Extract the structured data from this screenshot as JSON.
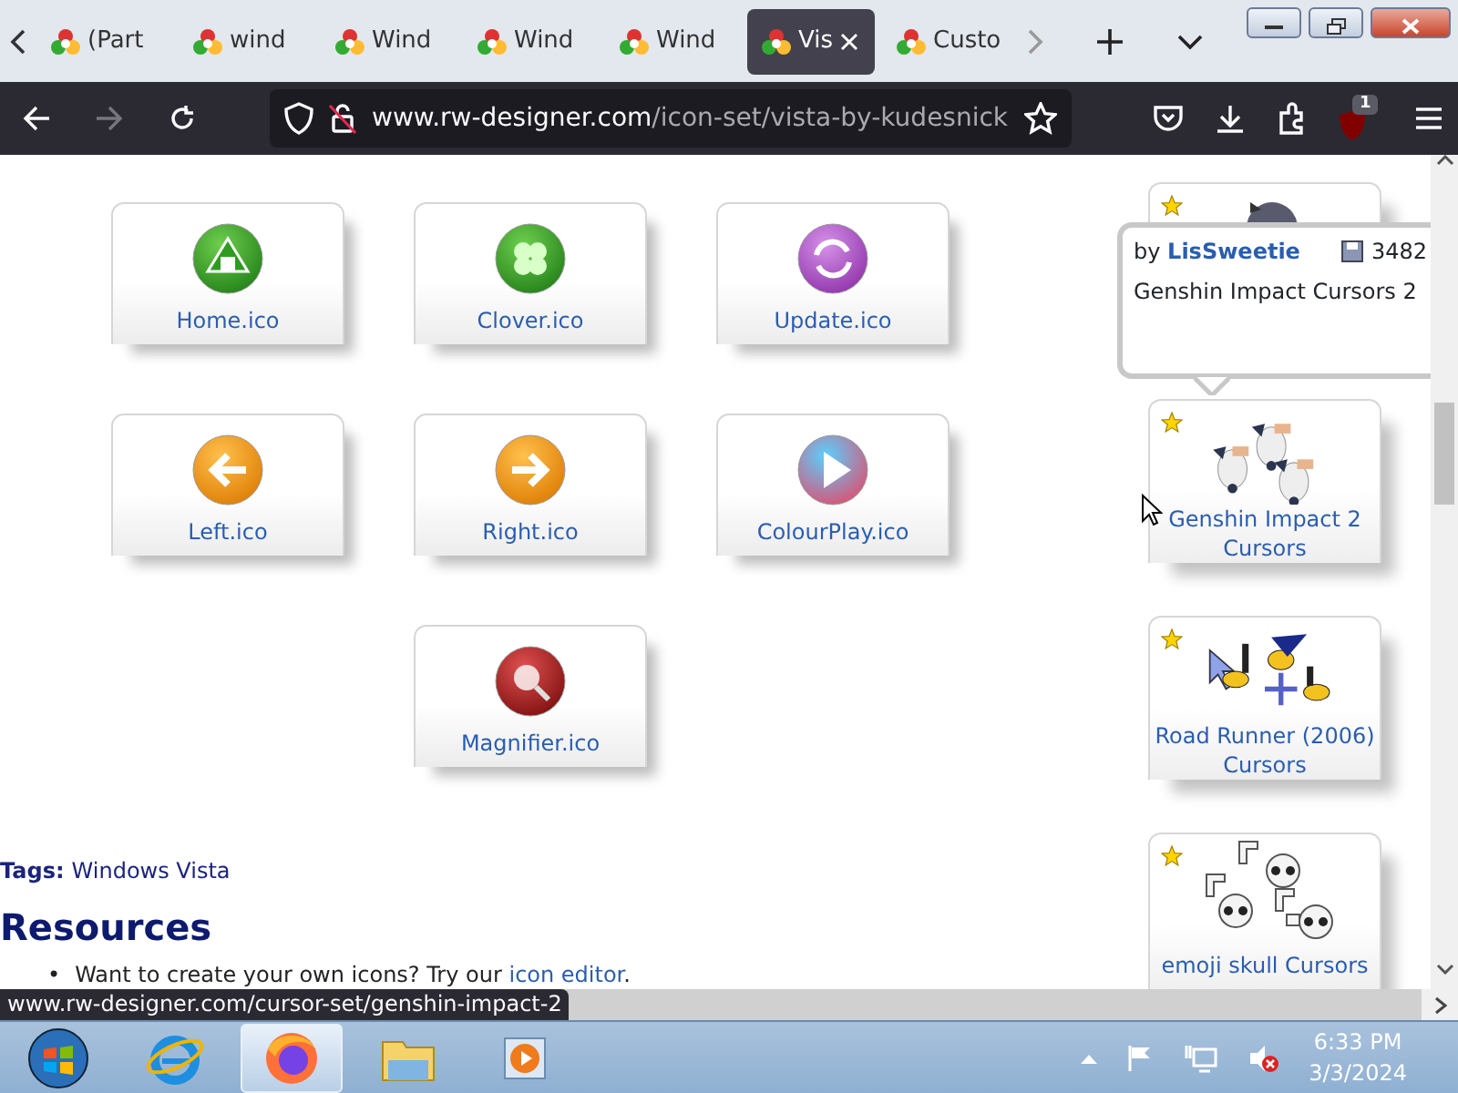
{
  "browser": {
    "tabs": [
      {
        "label": "(Part",
        "selected": false
      },
      {
        "label": "wind",
        "selected": false
      },
      {
        "label": "Wind",
        "selected": false
      },
      {
        "label": "Wind",
        "selected": false
      },
      {
        "label": "Wind",
        "selected": false
      },
      {
        "label": "Vis",
        "selected": true
      },
      {
        "label": "Custo",
        "selected": false
      }
    ],
    "address": {
      "host": "www.rw-designer.com",
      "path": "/icon-set/vista-by-kudesnick"
    },
    "extension_badge": "1"
  },
  "icon_rows": [
    {
      "items": [
        {
          "label": "Home.ico",
          "kind": "home"
        },
        {
          "label": "Clover.ico",
          "kind": "clover"
        },
        {
          "label": "Update.ico",
          "kind": "update"
        }
      ]
    },
    {
      "items": [
        {
          "label": "Left.ico",
          "kind": "left"
        },
        {
          "label": "Right.ico",
          "kind": "right"
        },
        {
          "label": "ColourPlay.ico",
          "kind": "play"
        }
      ]
    },
    {
      "items": [
        {
          "label": "Magnifier.ico",
          "kind": "magnifier"
        }
      ]
    }
  ],
  "tags": {
    "label": "Tags:",
    "value": "Windows Vista"
  },
  "resources": {
    "heading": "Resources",
    "items": [
      {
        "marker": "•",
        "text": "Want to create your own icons? Try our",
        "link": "icon editor",
        "end": "."
      }
    ]
  },
  "cursor_sets": [
    {
      "kind": "misty"
    },
    {
      "kind": "genshin",
      "label": "Genshin Impact 2 Cursors"
    },
    {
      "kind": "roadrunner",
      "label": "Road Runner (2006) Cursors"
    },
    {
      "kind": "skull",
      "label": "emoji skull Cursors"
    }
  ],
  "tooltip": {
    "by": "by",
    "author": "LisSweetie",
    "downloads": "3482",
    "title": "Genshin Impact Cursors 2"
  },
  "status_link": "www.rw-designer.com/cursor-set/genshin-impact-2",
  "taskbar": {
    "apps": [
      {
        "kind": "start",
        "selected": false
      },
      {
        "kind": "ie",
        "selected": false
      },
      {
        "kind": "firefox",
        "selected": true
      },
      {
        "kind": "explorer",
        "selected": false
      },
      {
        "kind": "media",
        "selected": false
      }
    ],
    "volume_muted": true,
    "time": "6:33 PM",
    "date": "3/3/2024"
  }
}
